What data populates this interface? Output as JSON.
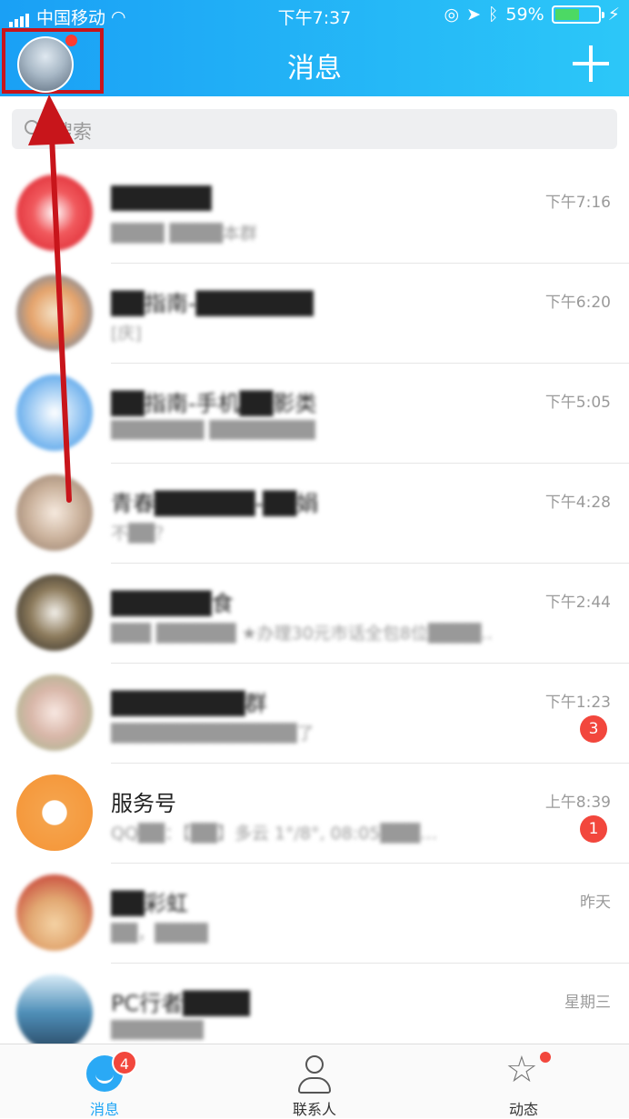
{
  "status_bar": {
    "carrier": "中国移动",
    "time": "下午7:37",
    "battery": "59%",
    "battery_level": 0.59
  },
  "header": {
    "title": "消息",
    "add_icon": "plus-icon",
    "avatar_badge_color": "#ff3b30"
  },
  "search": {
    "placeholder": "搜索"
  },
  "conversations": [
    {
      "name": "██████",
      "message": "████ ████本群",
      "time": "下午7:16",
      "badge": ""
    },
    {
      "name": "██指南-███████",
      "message": "[庆]",
      "time": "下午6:20",
      "badge": ""
    },
    {
      "name": "██指南-手机██影类",
      "message": "███████ ████████",
      "time": "下午5:05",
      "badge": ""
    },
    {
      "name": "青春██████-██娟",
      "message": "不██？",
      "time": "下午4:28",
      "badge": ""
    },
    {
      "name": "██████食",
      "message": "███ ██████     ★办理30元市话全包8位████…",
      "time": "下午2:44",
      "badge": ""
    },
    {
      "name": "████████群",
      "message": "██████████████了",
      "time": "下午1:23",
      "badge": "3"
    },
    {
      "name": "服务号",
      "message": "QQ██：【██】多云 1°/8°, 08:05███…",
      "time": "上午8:39",
      "badge": "1"
    },
    {
      "name": "██彩虹",
      "message": "██，████",
      "time": "昨天",
      "badge": ""
    },
    {
      "name": "PC行者████",
      "message": "███████",
      "time": "星期三",
      "badge": ""
    }
  ],
  "tabbar": {
    "messages_label": "消息",
    "messages_badge": "4",
    "contacts_label": "联系人",
    "feed_label": "动态"
  },
  "colors": {
    "header_start": "#1aa0f5",
    "header_end": "#2cc7f8",
    "badge": "#f2473d",
    "annotation": "#c8151b"
  }
}
